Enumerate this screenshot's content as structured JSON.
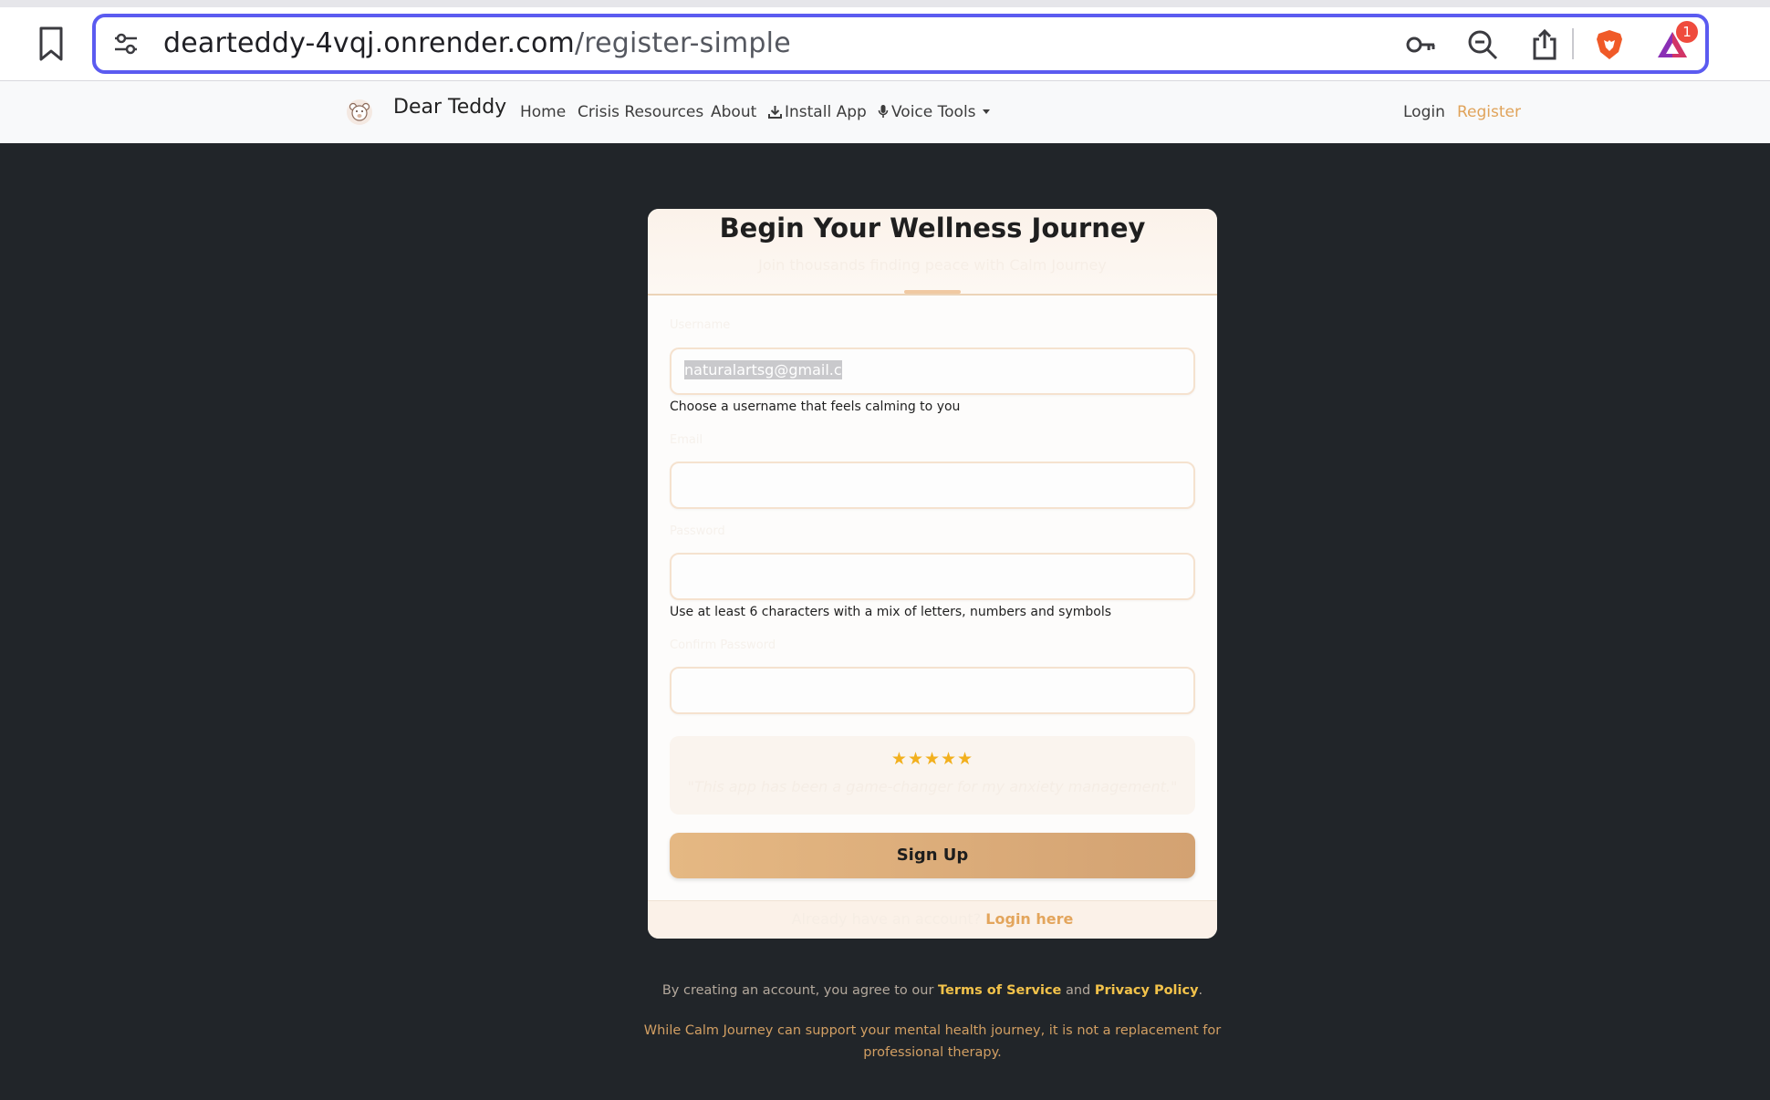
{
  "browser": {
    "url_host": "dearteddy-4vqj.onrender.com",
    "url_path": "/register-simple",
    "notification_count": "1"
  },
  "navbar": {
    "brand": "Dear Teddy",
    "links": [
      "Home",
      "Crisis Resources",
      "About",
      "Install App",
      "Voice Tools"
    ],
    "login": "Login",
    "register": "Register"
  },
  "card": {
    "title": "Begin Your Wellness Journey",
    "subtitle": "Join thousands finding peace with Calm Journey",
    "fields": [
      {
        "label": "Username",
        "value": "naturalartsg@gmail.c",
        "help": "Choose a username that feels calming to you"
      },
      {
        "label": "Email",
        "value": "",
        "help": ""
      },
      {
        "label": "Password",
        "value": "",
        "help": "Use at least 6 characters with a mix of letters, numbers and symbols"
      },
      {
        "label": "Confirm Password",
        "value": "",
        "help": ""
      }
    ],
    "testimonial": {
      "rating": 5,
      "stars": "★★★★★",
      "quote": "\"This app has been a game-changer for my anxiety management.\""
    },
    "signup_label": "Sign Up",
    "footer_text": "Already have an account?",
    "footer_link": "Login here"
  },
  "legal": {
    "prefix": "By creating an account, you agree to our",
    "terms": "Terms of Service",
    "and": "and",
    "privacy": "Privacy Policy",
    "period": ".",
    "disclaimer": "While Calm Journey can support your mental health journey, it is not a replacement for professional therapy."
  },
  "colors": {
    "accent": "#e3a55c",
    "url_focus": "#5b5bf0",
    "star": "#f2b01e",
    "page_bg": "#212529"
  }
}
